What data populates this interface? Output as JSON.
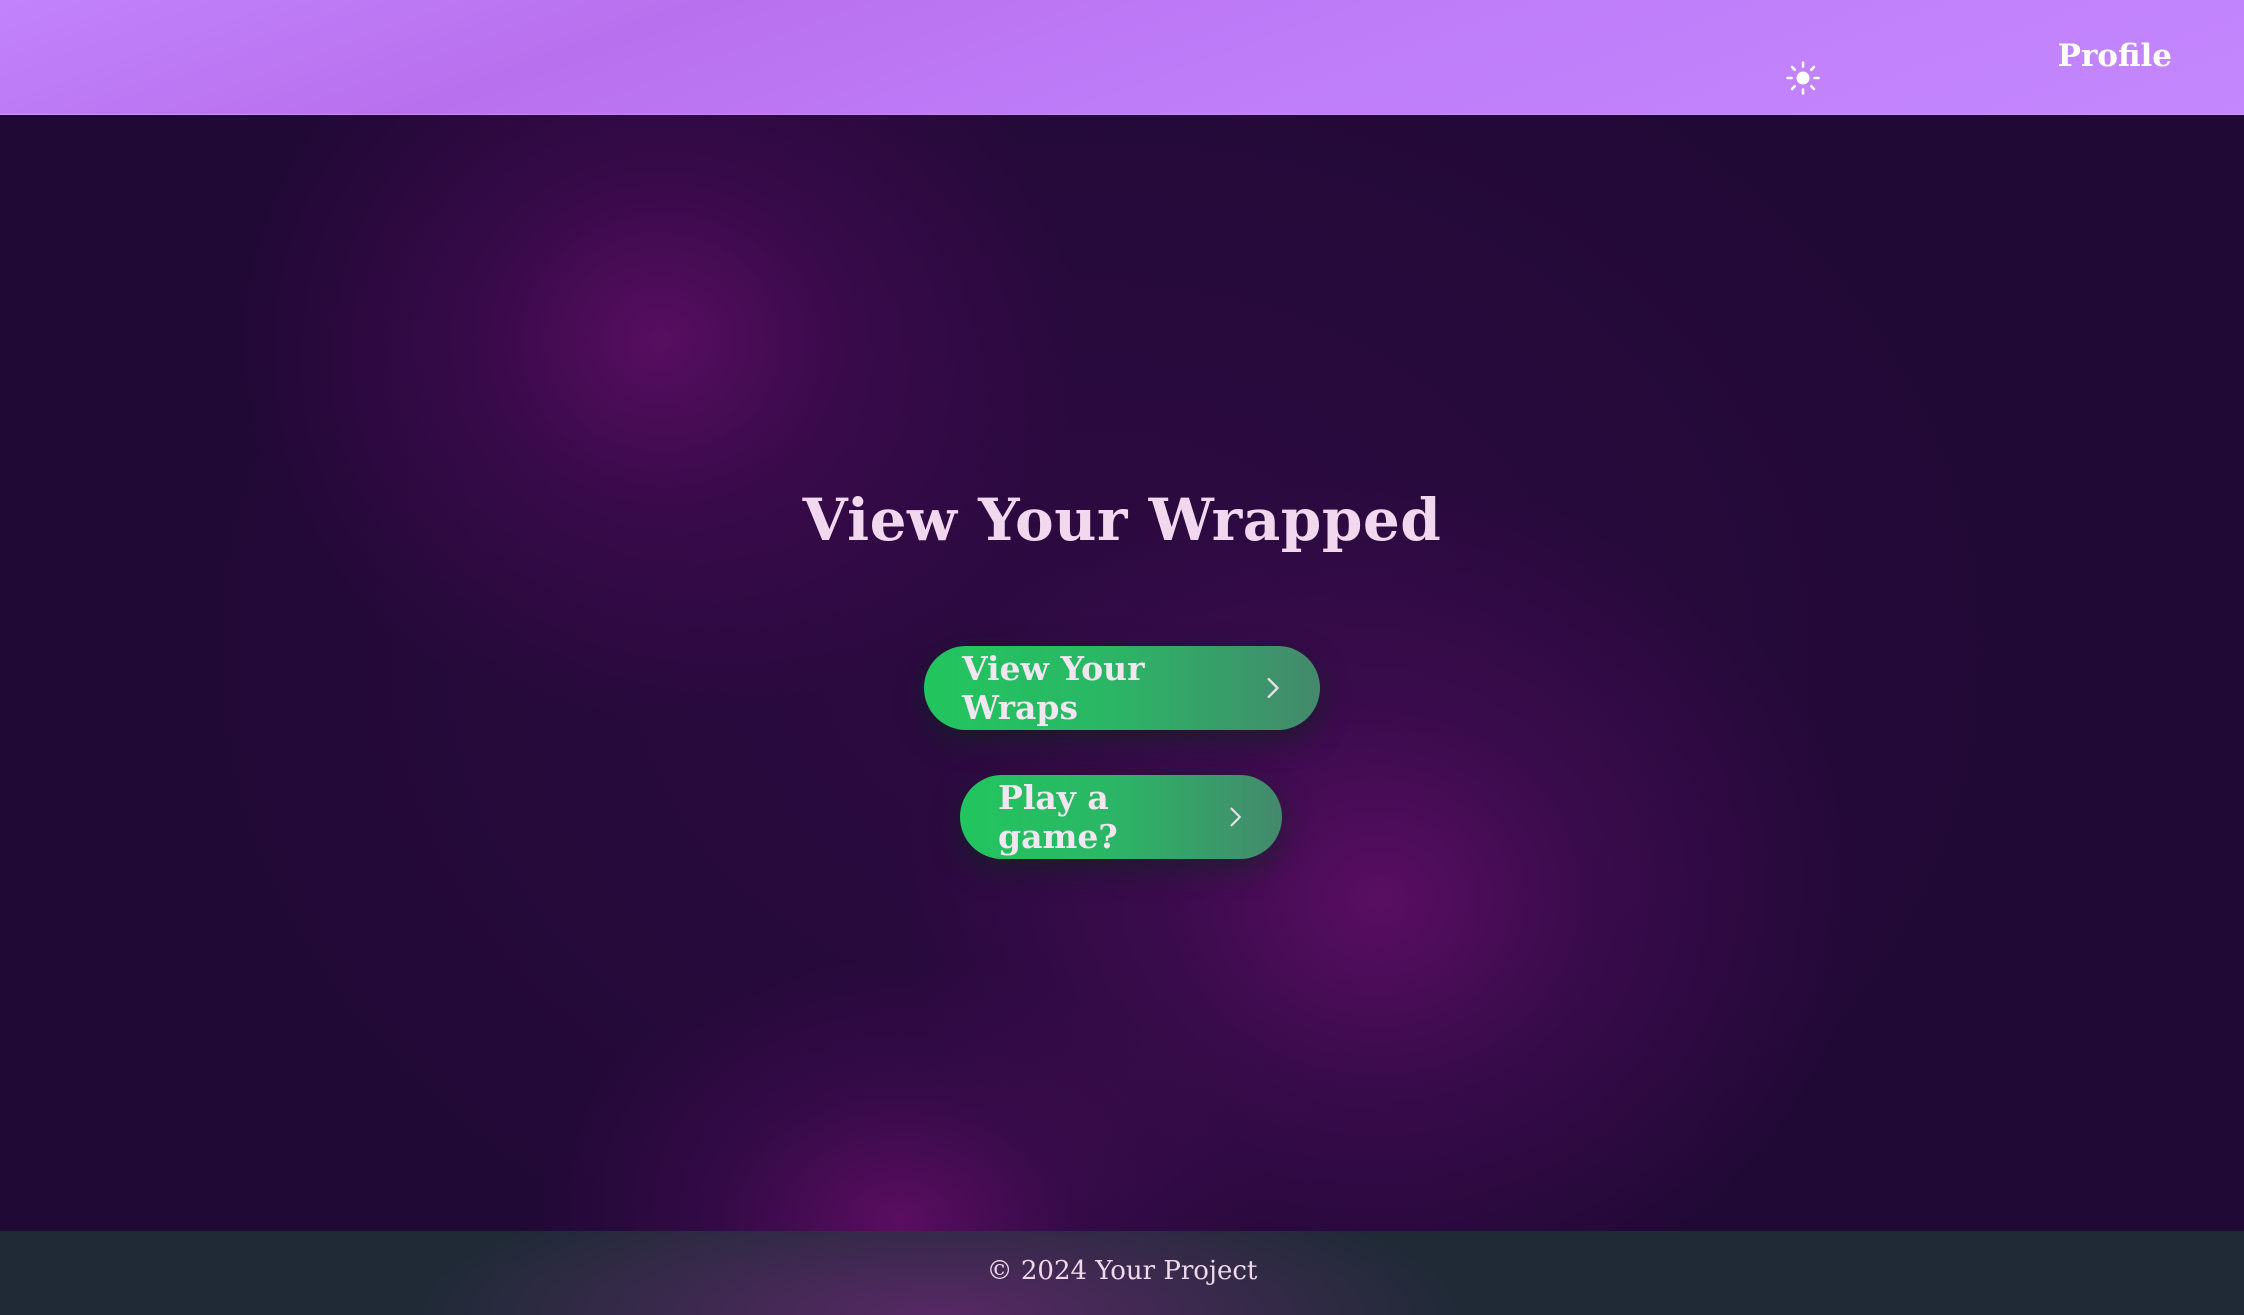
{
  "navbar": {
    "theme_toggle_icon": "sun-icon",
    "profile_label": "Profile"
  },
  "hero": {
    "title": "View Your Wrapped",
    "buttons": [
      {
        "label": "View Your Wraps",
        "icon": "chevron-right-icon"
      },
      {
        "label": "Play a game?",
        "icon": "chevron-right-icon"
      }
    ]
  },
  "footer": {
    "copyright": "© 2024 Your Project"
  },
  "colors": {
    "navbar_bg": "#c183fb",
    "page_bg": "#210936",
    "glow": "#5a0e62",
    "button_start": "#22c55e",
    "button_end": "#44896d",
    "title_text": "#f2d8ee",
    "footer_bg": "#202a37"
  }
}
